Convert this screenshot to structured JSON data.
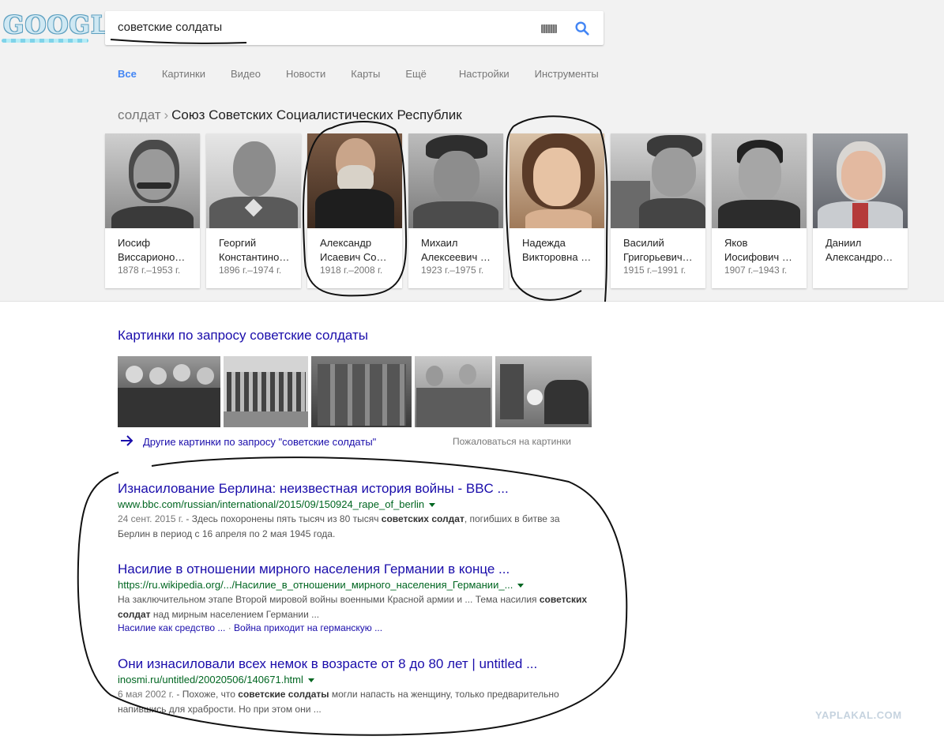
{
  "logo": {
    "text": "GOOGLE"
  },
  "search": {
    "query": "советские солдаты"
  },
  "tabs": [
    {
      "label": "Все",
      "active": true
    },
    {
      "label": "Картинки"
    },
    {
      "label": "Видео"
    },
    {
      "label": "Новости"
    },
    {
      "label": "Карты"
    },
    {
      "label": "Ещё"
    },
    {
      "label": "Настройки"
    },
    {
      "label": "Инструменты"
    }
  ],
  "breadcrumb": {
    "parent": "солдат",
    "separator": "›",
    "current": "Союз Советских Социалистических Республик"
  },
  "carousel": [
    {
      "name_line1": "Иосиф",
      "name_line2": "Виссарионо…",
      "years": "1878 г.–1953 г."
    },
    {
      "name_line1": "Георгий",
      "name_line2": "Константино…",
      "years": "1896 г.–1974 г."
    },
    {
      "name_line1": "Александр",
      "name_line2": "Исаевич Со…",
      "years": "1918 г.–2008 г."
    },
    {
      "name_line1": "Михаил",
      "name_line2": "Алексеевич …",
      "years": "1923 г.–1975 г."
    },
    {
      "name_line1": "Надежда",
      "name_line2": "Викторовна …",
      "years": ""
    },
    {
      "name_line1": "Василий",
      "name_line2": "Григорьевич…",
      "years": "1915 г.–1991 г."
    },
    {
      "name_line1": "Яков",
      "name_line2": "Иосифович …",
      "years": "1907 г.–1943 г."
    },
    {
      "name_line1": "Даниил",
      "name_line2": "Александро…",
      "years": ""
    }
  ],
  "images_section": {
    "title": "Картинки по запросу советские солдаты",
    "more_link": "Другие картинки по запросу \"советские солдаты\"",
    "report_link": "Пожаловаться на картинки"
  },
  "results": [
    {
      "title": "Изнасилование Берлина: неизвестная история войны - BBC ...",
      "url": "www.bbc.com/russian/international/2015/09/150924_rape_of_berlin",
      "date": "24 сент. 2015 г.",
      "snippet_pre": " - Здесь похоронены пять тысяч из 80 тысяч ",
      "snippet_bold": "советских солдат",
      "snippet_post": ", погибших в битве за Берлин в период с 16 апреля по 2 мая 1945 года."
    },
    {
      "title": "Насилие в отношении мирного населения Германии в конце ...",
      "url": "https://ru.wikipedia.org/.../Насилие_в_отношении_мирного_населения_Германии_...",
      "snippet_pre": "На заключительном этапе Второй мировой войны военными Красной армии и ... Тема насилия ",
      "snippet_bold": "советских солдат",
      "snippet_post": " над мирным населением Германии ...",
      "sublink1": "Насилие как средство ...",
      "sublink_sep": " · ",
      "sublink2": "Война приходит на германскую ..."
    },
    {
      "title": "Они изнасиловали всех немок в возрасте от 8 до 80 лет | untitled ...",
      "url": "inosmi.ru/untitled/20020506/140671.html",
      "date": "6 мая 2002 г.",
      "snippet_pre": " - Похоже, что ",
      "snippet_bold": "советские солдаты",
      "snippet_post": " могли напасть на женщину, только предварительно напившись для храбрости. Но при этом они ..."
    }
  ],
  "watermark": "YAPLAKAL.COM"
}
